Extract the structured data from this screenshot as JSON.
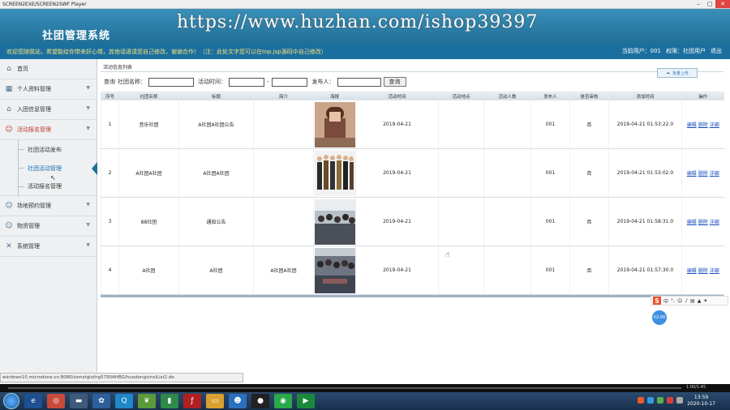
{
  "window": {
    "title": "SCREEN2EXE/SCREEN2SWF Player"
  },
  "watermark": "https://www.huzhan.com/ishop39397",
  "header": {
    "logo": "社团管理系统"
  },
  "message_bar": {
    "welcome": "欢迎您随我站，希望能给你带来好心情，其他话语请您自己修改，谢谢合作！（注：此处文字您可以在top.jsp源码中自己修改）",
    "current_user": "当前用户：001",
    "role": "权限：社团用户",
    "logout": "退出"
  },
  "sidebar": {
    "home": "首页",
    "items": [
      {
        "label": "个人资料管理",
        "icon": "grid-icon"
      },
      {
        "label": "入团信息管理",
        "icon": "house-icon"
      },
      {
        "label": "活动报名管理",
        "icon": "users-icon"
      }
    ],
    "subitems": [
      "社团活动发布",
      "社团活动管理",
      "活动报名管理"
    ],
    "items_after": [
      {
        "label": "场地预约管理",
        "icon": "users-icon"
      },
      {
        "label": "物资管理",
        "icon": "users-icon"
      },
      {
        "label": "系统管理",
        "icon": "tools-icon"
      }
    ]
  },
  "main": {
    "breadcrumb": "活动信息列表",
    "upload_btn": "批量上传",
    "filter": {
      "query": "查询",
      "club_label": "社团名称：",
      "time_label": "活动时间：",
      "time_sep": "-",
      "publisher_label": "发布人：",
      "search_btn": "查询"
    },
    "columns": [
      "序号",
      "社团名称",
      "标题",
      "简介",
      "海报",
      "活动时间",
      "活动地点",
      "活动人数",
      "发布人",
      "是否审核",
      "添加时间",
      "操作"
    ],
    "rows": [
      {
        "no": "1",
        "club": "音乐社团",
        "title": "A社团A社团公告",
        "intro": "",
        "time": "2019-04-21",
        "place": "",
        "count": "",
        "publisher": "001",
        "audit": "否",
        "added": "2019-04-21 01:53:22.0"
      },
      {
        "no": "2",
        "club": "A社团A社团",
        "title": "A社团A社团",
        "intro": "",
        "time": "2019-04-21",
        "place": "",
        "count": "",
        "publisher": "001",
        "audit": "否",
        "added": "2019-04-21 01:53:02.0"
      },
      {
        "no": "3",
        "club": "88社团",
        "title": "通知公告",
        "intro": "",
        "time": "2019-04-21",
        "place": "",
        "count": "",
        "publisher": "001",
        "audit": "否",
        "added": "2019-04-21 01:58:31.0"
      },
      {
        "no": "4",
        "club": "A社团",
        "title": "A社团",
        "intro": "A社团A社团",
        "time": "2019-04-21",
        "place": "",
        "count": "",
        "publisher": "001",
        "audit": "否",
        "added": "2019-04-21 01:57:30.0"
      }
    ],
    "ops": [
      "编辑",
      "删除",
      "详细"
    ]
  },
  "ime": {
    "logo": "S",
    "lang": "中"
  },
  "timer": "02:00",
  "status_url": "windows10.microdone.cn:8080/ssmstglxthg5790AHBG/huodongxinxiList2.do",
  "player": {
    "time": "1:00/1:45"
  },
  "taskbar": {
    "time": "13:59",
    "date": "2020-10-17"
  }
}
